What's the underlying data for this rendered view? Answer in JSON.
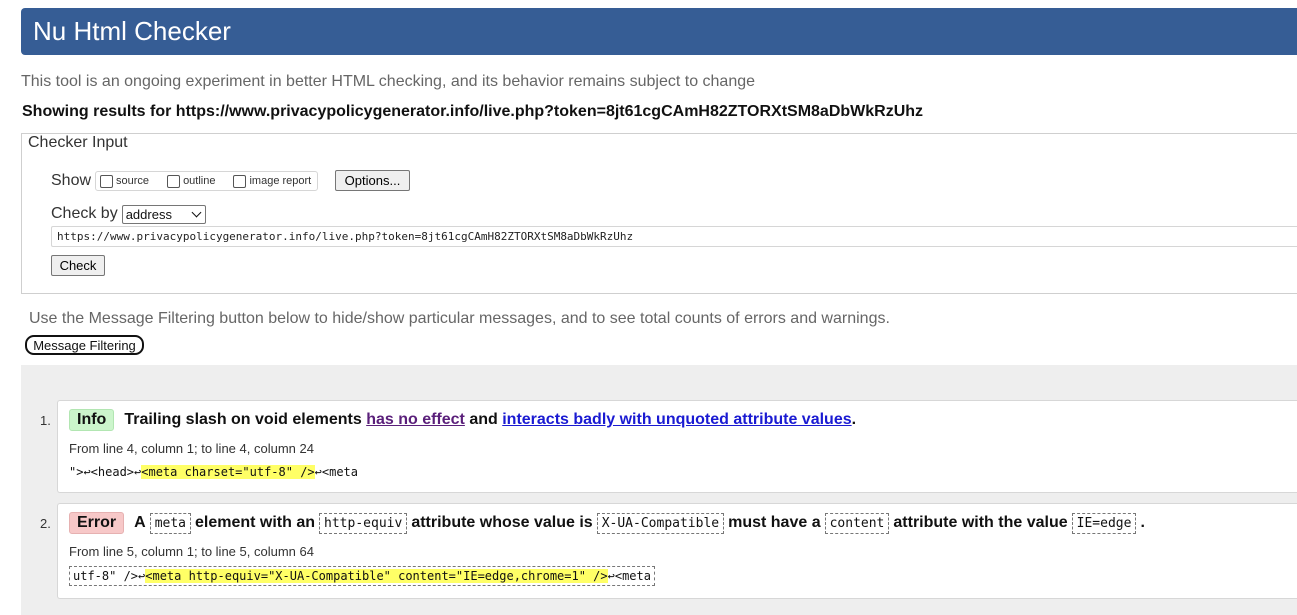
{
  "header": {
    "title": "Nu Html Checker"
  },
  "intro": "This tool is an ongoing experiment in better HTML checking, and its behavior remains subject to change",
  "showing_results": "Showing results for https://www.privacypolicygenerator.info/live.php?token=8jt61cgCAmH82ZTORXtSM8aDbWkRzUhz",
  "checker_input": {
    "legend": "Checker Input",
    "show_label": "Show",
    "show_options": [
      {
        "label": "source",
        "checked": false
      },
      {
        "label": "outline",
        "checked": false
      },
      {
        "label": "image report",
        "checked": false
      }
    ],
    "options_button": "Options...",
    "check_by_label": "Check by",
    "check_by_value": "address",
    "url_value": "https://www.privacypolicygenerator.info/live.php?token=8jt61cgCAmH82ZTORXtSM8aDbWkRzUhz",
    "check_button": "Check"
  },
  "filter": {
    "hint": "Use the Message Filtering button below to hide/show particular messages, and to see total counts of errors and warnings.",
    "button": "Message Filtering"
  },
  "messages": [
    {
      "number": "1.",
      "type": "Info",
      "text_a": "Trailing slash on void elements",
      "link1": "has no effect",
      "text_b": "and",
      "link2": "interacts badly with unquoted attribute values",
      "text_c": ".",
      "location": "From line 4, column 1; to line 4, column 24",
      "extract_before": "\">↩<head>↩",
      "extract_highlight": "<meta charset=\"utf-8\" />",
      "extract_after": "↩<meta"
    },
    {
      "number": "2.",
      "type": "Error",
      "t1": "A",
      "c1": "meta",
      "t2": "element with an",
      "c2": "http-equiv",
      "t3": "attribute whose value is",
      "c3": "X-UA-Compatible",
      "t4": "must have a",
      "c4": "content",
      "t5": "attribute with the value",
      "c5": "IE=edge",
      "t6": ".",
      "location": "From line 5, column 1; to line 5, column 64",
      "extract_before": "utf-8\" />↩",
      "extract_highlight": "<meta http-equiv=\"X-UA-Compatible\" content=\"IE=edge,chrome=1\" />",
      "extract_after": "↩<meta"
    }
  ]
}
